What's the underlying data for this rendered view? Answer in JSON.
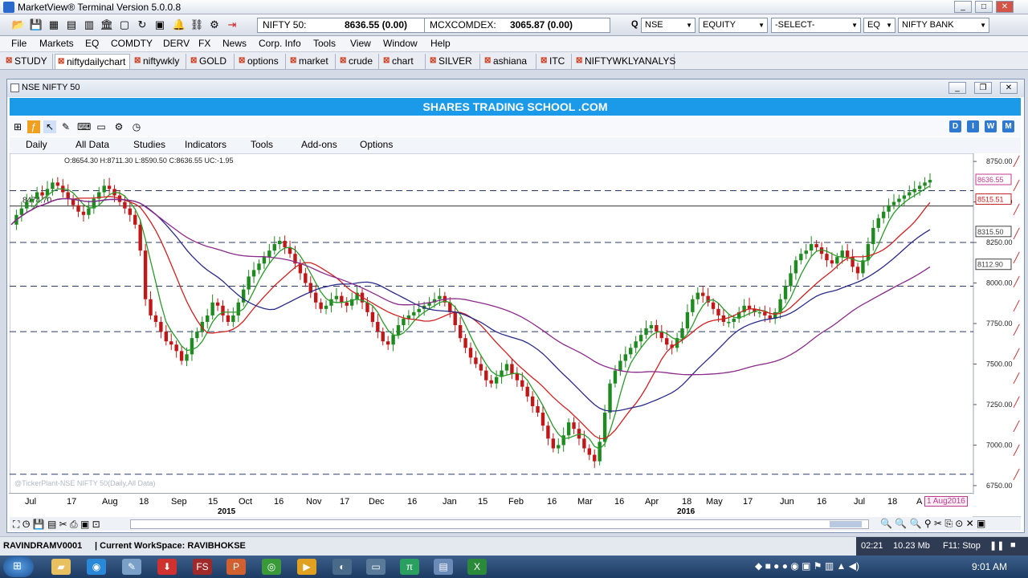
{
  "app": {
    "title": "MarketView®  Terminal Version  5.0.0.8"
  },
  "quotes": [
    {
      "label": "NIFTY 50:",
      "value": "8636.55 (0.00)"
    },
    {
      "label": "MCXCOMDEX:",
      "value": "3065.87 (0.00)"
    }
  ],
  "search": {
    "q_label": "Q",
    "exchange": "NSE",
    "segment": "EQUITY",
    "select": "-SELECT-",
    "series": "EQ",
    "symbol": "NIFTY BANK"
  },
  "menu": [
    "File",
    "Markets",
    "EQ",
    "COMDTY",
    "DERV",
    "FX",
    "News",
    "Corp. Info",
    "Tools",
    "View",
    "Window",
    "Help"
  ],
  "tabs": [
    "STUDY",
    "niftydailychart",
    "niftywkly",
    "GOLD",
    "options",
    "market",
    "crude",
    "chart",
    "SILVER",
    "ashiana",
    "ITC",
    "NIFTYWKLYANALYS"
  ],
  "active_tab": 1,
  "chart_window": {
    "title": "NSE NIFTY 50",
    "banner": "SHARES TRADING SCHOOL .COM",
    "menu": [
      "Daily",
      "All Data",
      "Studies",
      "Indicators",
      "Tools",
      "Add-ons",
      "Options"
    ],
    "dwm": [
      "D",
      "I",
      "W",
      "M"
    ],
    "ohlc": "O:8654.30  H:8711.30  L:8590.50  C:8636.55  UC:-1.95",
    "watermark": "@TickerPlant-NSE NIFTY 50(Daily,All Data)",
    "level_label": "8474.70",
    "date_tag": "1 Aug2016"
  },
  "chart_data": {
    "type": "line",
    "y_range": [
      6700,
      8800
    ],
    "y_ticks": [
      "8750.00",
      "8500.00",
      "8250.00",
      "8000.00",
      "7750.00",
      "7500.00",
      "7250.00",
      "7000.00",
      "6750.00"
    ],
    "y_tick_values": [
      8750,
      8500,
      8250,
      8000,
      7750,
      7500,
      7250,
      7000,
      6750
    ],
    "price_tags": [
      {
        "label": "8636.55",
        "value": 8636.55,
        "color": "#c03a8a"
      },
      {
        "label": "8515.51",
        "value": 8515.51,
        "color": "#c02020"
      },
      {
        "label": "8315.50",
        "value": 8315.5,
        "color": "#404040"
      },
      {
        "label": "8112.90",
        "value": 8112.9,
        "color": "#404040"
      }
    ],
    "x_ticks": [
      "Jul",
      "17",
      "Aug",
      "18",
      "Sep",
      "15",
      "Oct",
      "16",
      "Nov",
      "17",
      "Dec",
      "16",
      "Jan",
      "15",
      "Feb",
      "16",
      "Mar",
      "16",
      "Apr",
      "18",
      "May",
      "17",
      "Jun",
      "16",
      "Jul",
      "18",
      "A"
    ],
    "years": [
      "2015",
      "2016"
    ],
    "horizontal_levels": [
      8570,
      8474.7,
      8250,
      7980,
      7700,
      6820
    ],
    "close": [
      8360,
      8420,
      8460,
      8500,
      8520,
      8560,
      8540,
      8580,
      8620,
      8600,
      8560,
      8520,
      8480,
      8440,
      8420,
      8460,
      8520,
      8560,
      8600,
      8580,
      8540,
      8500,
      8460,
      8420,
      8360,
      8200,
      7900,
      7800,
      7760,
      7700,
      7640,
      7620,
      7580,
      7520,
      7560,
      7660,
      7700,
      7760,
      7800,
      7880,
      7860,
      7800,
      7760,
      7800,
      7880,
      7960,
      8040,
      8080,
      8120,
      8160,
      8200,
      8240,
      8260,
      8220,
      8180,
      8120,
      8060,
      8000,
      7940,
      7880,
      7840,
      7860,
      7900,
      7920,
      7880,
      7860,
      7900,
      7940,
      7880,
      7820,
      7760,
      7700,
      7640,
      7620,
      7680,
      7740,
      7780,
      7800,
      7820,
      7840,
      7860,
      7880,
      7900,
      7920,
      7880,
      7820,
      7740,
      7660,
      7600,
      7540,
      7500,
      7460,
      7400,
      7380,
      7420,
      7460,
      7500,
      7440,
      7400,
      7360,
      7300,
      7240,
      7200,
      7120,
      7040,
      6980,
      7000,
      7060,
      7140,
      7100,
      7040,
      6980,
      6940,
      6900,
      7020,
      7200,
      7380,
      7460,
      7520,
      7560,
      7600,
      7640,
      7680,
      7720,
      7740,
      7700,
      7660,
      7620,
      7600,
      7660,
      7720,
      7820,
      7900,
      7940,
      7920,
      7880,
      7840,
      7800,
      7760,
      7760,
      7780,
      7820,
      7860,
      7840,
      7820,
      7820,
      7800,
      7780,
      7820,
      7900,
      7980,
      8060,
      8140,
      8180,
      8200,
      8240,
      8220,
      8180,
      8140,
      8120,
      8160,
      8200,
      8160,
      8100,
      8060,
      8140,
      8240,
      8340,
      8400,
      8440,
      8480,
      8500,
      8520,
      8540,
      8560,
      8580,
      8600,
      8620,
      8636
    ],
    "series": [
      {
        "stroke": "#2a9a2a",
        "period": 5
      },
      {
        "stroke": "#d02020",
        "period": 13
      },
      {
        "stroke": "#2a2a8a",
        "period": 26
      },
      {
        "stroke": "#8a2a8a",
        "period": 50
      }
    ]
  },
  "status": {
    "user": "RAVINDRAMV0001",
    "workspace": "| Current WorkSpace: RAVIBHOKSE",
    "time": "02:21",
    "mem": "10.23 Mb",
    "f11": "F11: Stop"
  },
  "clock": "9:01 AM"
}
